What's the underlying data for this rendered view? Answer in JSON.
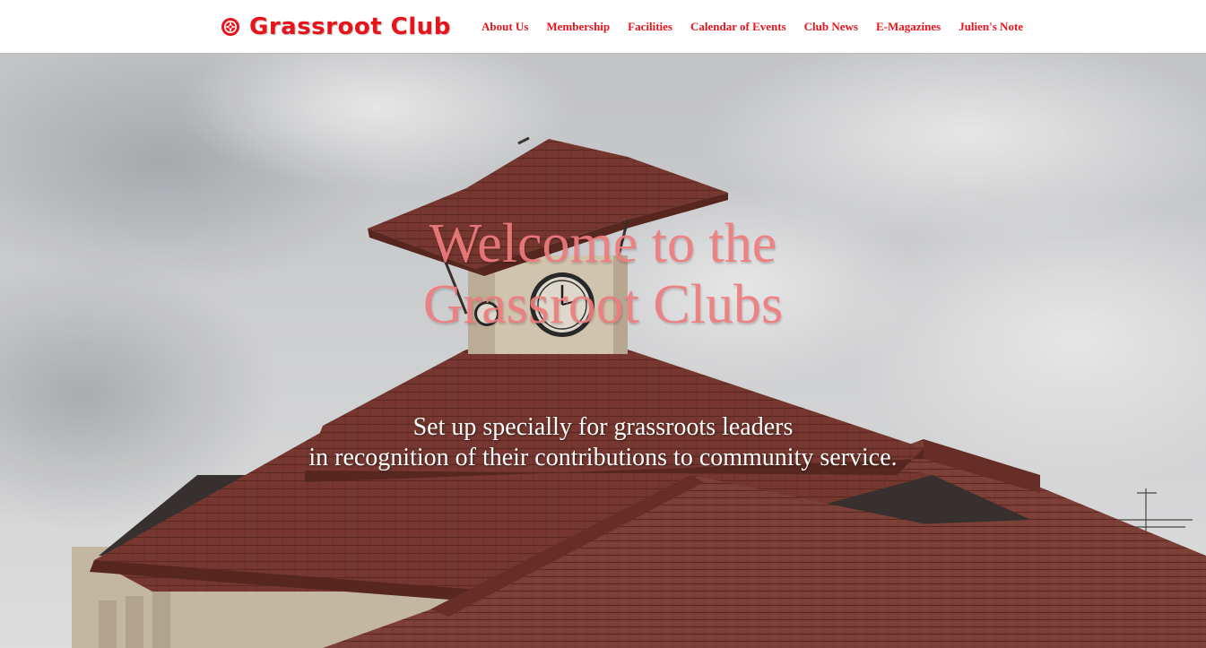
{
  "header": {
    "brand_name": "Grassroot Club",
    "brand_icon": "club-emblem-icon",
    "brand_color": "#e8141c",
    "nav": [
      {
        "label": "About Us"
      },
      {
        "label": "Membership"
      },
      {
        "label": "Facilities"
      },
      {
        "label": "Calendar of Events"
      },
      {
        "label": "Club News"
      },
      {
        "label": "E-Magazines"
      },
      {
        "label": "Julien's Note"
      }
    ]
  },
  "hero": {
    "headline_line1": "Welcome to the",
    "headline_line2": "Grassroot Clubs",
    "headline_color": "#ef7b7d",
    "subline_line1": "Set up specially for grassroots leaders",
    "subline_line2": "in recognition of their contributions to community service.",
    "background_image": "clock tower building with red-tiled roofs under a cloudy sky"
  }
}
